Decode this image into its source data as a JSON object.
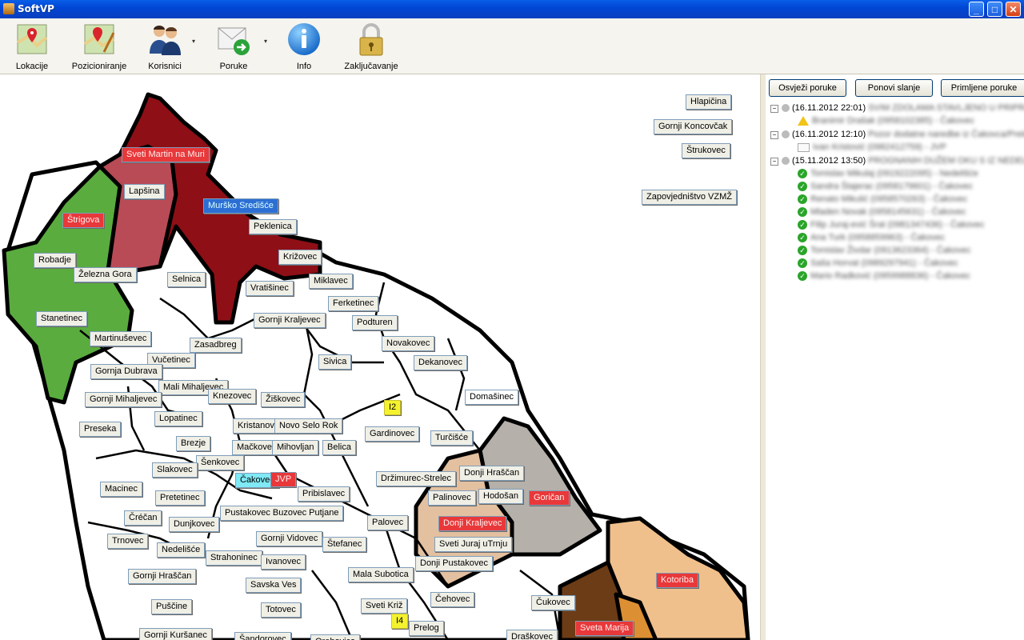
{
  "window": {
    "title": "SoftVP",
    "controls": {
      "minimize": "_",
      "maximize": "□",
      "close": "✕"
    }
  },
  "toolbar": {
    "items": [
      {
        "label": "Lokacije",
        "icon": "map-location-icon"
      },
      {
        "label": "Pozicioniranje",
        "icon": "map-positioning-icon"
      },
      {
        "label": "Korisnici",
        "icon": "users-icon",
        "dropdown": "▾"
      },
      {
        "label": "Poruke",
        "icon": "envelope-send-icon",
        "dropdown": "▾"
      },
      {
        "label": "Info",
        "icon": "info-icon"
      },
      {
        "label": "Zaključavanje",
        "icon": "padlock-icon"
      }
    ]
  },
  "map": {
    "colors": {
      "green": "#5aac3f",
      "rose": "#b94b56",
      "darkred": "#8e0f16",
      "gray": "#b5b0aa",
      "tan": "#e3c0a0",
      "peach": "#f0c08c",
      "brown": "#6b3c16",
      "orange": "#dd8f33"
    },
    "labels": [
      {
        "text": "Hlapičina",
        "style": ""
      },
      {
        "text": "Gornji Koncovčak",
        "style": ""
      },
      {
        "text": "Štrukovec",
        "style": ""
      },
      {
        "text": "Zapovjedništvo VZMŽ",
        "style": ""
      },
      {
        "text": "Sveti Martin na Muri",
        "style": "red"
      },
      {
        "text": "Lapšina",
        "style": ""
      },
      {
        "text": "Murško Središće",
        "style": "blue"
      },
      {
        "text": "Štrigova",
        "style": "red"
      },
      {
        "text": "Peklenica",
        "style": ""
      },
      {
        "text": "Robadje",
        "style": ""
      },
      {
        "text": "Križovec",
        "style": ""
      },
      {
        "text": "Železna Gora",
        "style": ""
      },
      {
        "text": "Selnica",
        "style": ""
      },
      {
        "text": "Miklavec",
        "style": ""
      },
      {
        "text": "Vratišinec",
        "style": ""
      },
      {
        "text": "Ferketinec",
        "style": ""
      },
      {
        "text": "Stanetinec",
        "style": ""
      },
      {
        "text": "Gornji Kraljevec",
        "style": ""
      },
      {
        "text": "Podturen",
        "style": ""
      },
      {
        "text": "Martinuševec",
        "style": ""
      },
      {
        "text": "Zasadbreg",
        "style": ""
      },
      {
        "text": "Novakovec",
        "style": ""
      },
      {
        "text": "Vučetinec",
        "style": ""
      },
      {
        "text": "Sivica",
        "style": ""
      },
      {
        "text": "Dekanovec",
        "style": ""
      },
      {
        "text": "Gornja Dubrava",
        "style": ""
      },
      {
        "text": "Mali Mihaljevec",
        "style": ""
      },
      {
        "text": "Gornji Mihaljevec",
        "style": ""
      },
      {
        "text": "Knezovec",
        "style": ""
      },
      {
        "text": "Žiškovec",
        "style": ""
      },
      {
        "text": "Domašinec",
        "style": "white"
      },
      {
        "text": "I2",
        "style": "yellow"
      },
      {
        "text": "Lopatinec",
        "style": ""
      },
      {
        "text": "Kristanovec",
        "style": ""
      },
      {
        "text": "Novo Selo Rok",
        "style": ""
      },
      {
        "text": "Preseka",
        "style": ""
      },
      {
        "text": "Gardinovec",
        "style": ""
      },
      {
        "text": "Turčišće",
        "style": ""
      },
      {
        "text": "Brezje",
        "style": ""
      },
      {
        "text": "Mačkovec",
        "style": ""
      },
      {
        "text": "Mihovljan",
        "style": ""
      },
      {
        "text": "Belica",
        "style": ""
      },
      {
        "text": "Šenkovec",
        "style": ""
      },
      {
        "text": "Slakovec",
        "style": ""
      },
      {
        "text": "Donji Hraščan",
        "style": ""
      },
      {
        "text": "Držimurec-Strelec",
        "style": ""
      },
      {
        "text": "Čakovec",
        "style": "cyan"
      },
      {
        "text": "JVP",
        "style": "red"
      },
      {
        "text": "Macinec",
        "style": ""
      },
      {
        "text": "Pribislavec",
        "style": ""
      },
      {
        "text": "Hodošan",
        "style": ""
      },
      {
        "text": "Goričan",
        "style": "red"
      },
      {
        "text": "Pretetinec",
        "style": ""
      },
      {
        "text": "Palinovec",
        "style": ""
      },
      {
        "text": "Čréčan",
        "style": ""
      },
      {
        "text": "Pustakovec Buzovec Putjane",
        "style": ""
      },
      {
        "text": "Dunjkovec",
        "style": ""
      },
      {
        "text": "Palovec",
        "style": ""
      },
      {
        "text": "Donji Kraljevec",
        "style": "red"
      },
      {
        "text": "Trnovec",
        "style": ""
      },
      {
        "text": "Gornji Vidovec",
        "style": ""
      },
      {
        "text": "Nedelišće",
        "style": ""
      },
      {
        "text": "Štefanec",
        "style": ""
      },
      {
        "text": "Sveti Juraj uTrnju",
        "style": ""
      },
      {
        "text": "Strahoninec",
        "style": ""
      },
      {
        "text": "Ivanovec",
        "style": ""
      },
      {
        "text": "Donji Pustakovec",
        "style": ""
      },
      {
        "text": "Gornji Hraščan",
        "style": ""
      },
      {
        "text": "Mala Subotica",
        "style": ""
      },
      {
        "text": "Kotoriba",
        "style": "red"
      },
      {
        "text": "Savska Ves",
        "style": ""
      },
      {
        "text": "Čehovec",
        "style": ""
      },
      {
        "text": "Sveti Križ",
        "style": ""
      },
      {
        "text": "Čukovec",
        "style": ""
      },
      {
        "text": "Puščine",
        "style": ""
      },
      {
        "text": "Totovec",
        "style": ""
      },
      {
        "text": "I4",
        "style": "yellow"
      },
      {
        "text": "Prelog",
        "style": ""
      },
      {
        "text": "Sveta Marija",
        "style": "red"
      },
      {
        "text": "Gornji Kuršanec",
        "style": ""
      },
      {
        "text": "Šandorovec",
        "style": ""
      },
      {
        "text": "Orehovica",
        "style": ""
      },
      {
        "text": "Draškovec",
        "style": ""
      }
    ]
  },
  "messages": {
    "buttons": [
      "Osvježi poruke",
      "Ponovi slanje",
      "Primljene poruke"
    ],
    "groups": [
      {
        "timestamp": "(16.11.2012 22:01)",
        "subject": "SVIM ZDOLAMA STAVLJENO U PRIPRAVNOST",
        "children": [
          {
            "icon": "warning-icon",
            "text": "Branimir Drašak (0958102385) - Čakovec"
          }
        ]
      },
      {
        "timestamp": "(16.11.2012 12:10)",
        "subject": "Pozor dodatne naredbe iz Čakovca/Prelog",
        "children": [
          {
            "icon": "mail-icon",
            "text": "Ivan Kristović (0982412759) - JVP"
          }
        ]
      },
      {
        "timestamp": "(15.11.2012 13:50)",
        "subject": "PROGNANIH DUŽEM OKU S IZ NEDELIŠĆA",
        "children": [
          {
            "icon": "check-icon",
            "text": "Tomislav Mikulaj (0919222095) - Nedelišće"
          },
          {
            "icon": "check-icon",
            "text": "Sandra Štajerac (0958179601) - Čakovec"
          },
          {
            "icon": "check-icon",
            "text": "Renato Mikulić (0958570263) - Čakovec"
          },
          {
            "icon": "check-icon",
            "text": "Mladen Novak (0958145631) - Čakovec"
          },
          {
            "icon": "check-icon",
            "text": "Filip Juraj-ević Šrat (0981347436) - Čakovec"
          },
          {
            "icon": "check-icon",
            "text": "Ana Turk (0958859963) - Čakovec"
          },
          {
            "icon": "check-icon",
            "text": "Tomislav Živdar (0913623364) - Čakovec"
          },
          {
            "icon": "check-icon",
            "text": "Saša Horvat (0989297941) - Čakovec"
          },
          {
            "icon": "check-icon",
            "text": "Mario Radković (0959988836) - Čakovec"
          }
        ]
      }
    ]
  }
}
